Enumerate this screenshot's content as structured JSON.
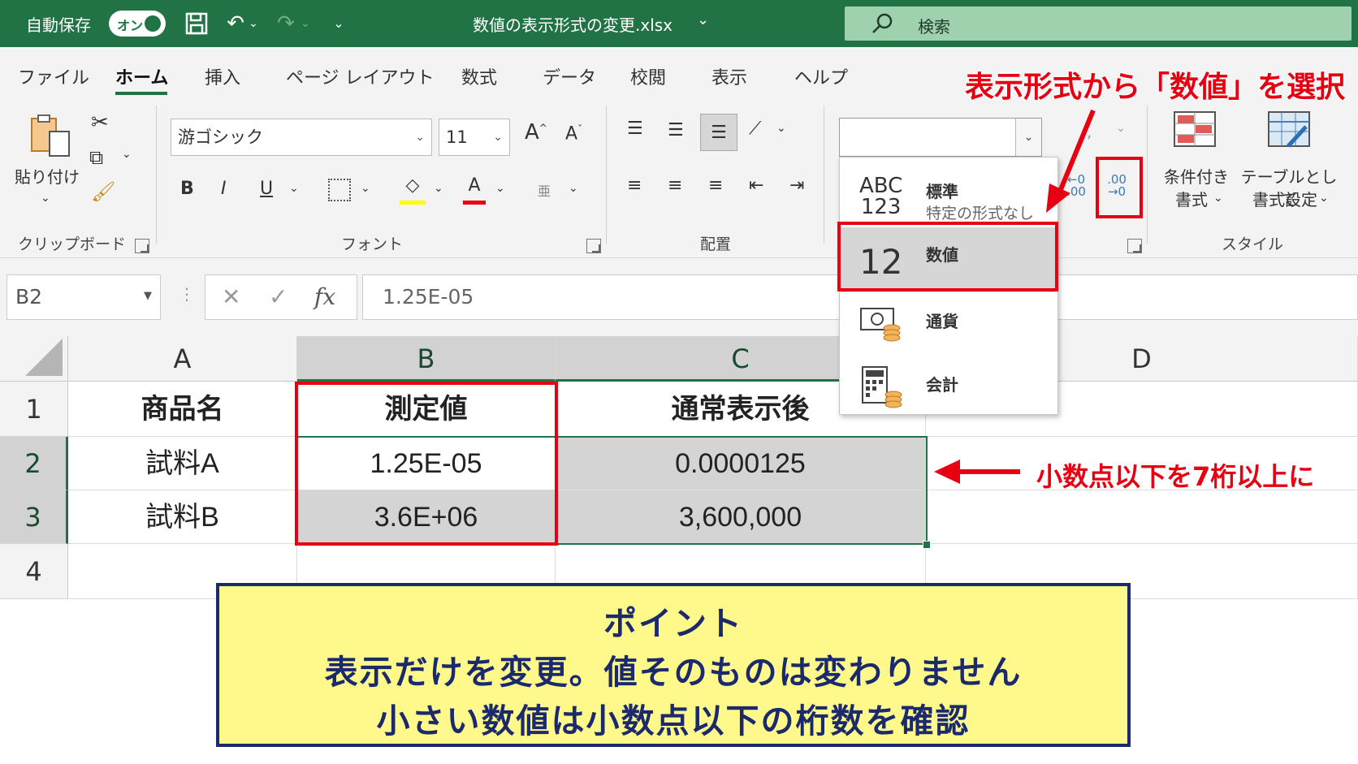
{
  "titlebar": {
    "autosave_label": "自動保存",
    "autosave_state": "オン",
    "document_title": "数値の表示形式の変更.xlsx",
    "search_placeholder": "検索",
    "accent_color": "#217346"
  },
  "tabs": [
    "ファイル",
    "ホーム",
    "挿入",
    "ページ レイアウト",
    "数式",
    "データ",
    "校閲",
    "表示",
    "ヘルプ"
  ],
  "active_tab": "ホーム",
  "ribbon": {
    "clipboard": {
      "paste_label": "貼り付け",
      "group_label": "クリップボード"
    },
    "font": {
      "font_name": "游ゴシック",
      "font_size": "11",
      "group_label": "フォント"
    },
    "alignment": {
      "group_label": "配置"
    },
    "styles": {
      "conditional_label_1": "条件付き",
      "conditional_label_2": "書式",
      "table_label_1": "テーブルとして",
      "table_label_2": "書式設定",
      "group_label": "スタイル"
    }
  },
  "number_format_dropdown": {
    "items": [
      {
        "icon": "abc-123-icon",
        "icon_text_1": "ABC",
        "icon_text_2": "123",
        "title": "標準",
        "subtitle": "特定の形式なし"
      },
      {
        "icon": "number-12-icon",
        "icon_text_1": "12",
        "title": "数値"
      },
      {
        "icon": "currency-icon",
        "title": "通貨"
      },
      {
        "icon": "accounting-icon",
        "title": "会計"
      }
    ],
    "selected": "数値"
  },
  "formula_bar": {
    "name_box": "B2",
    "formula": "1.25E-05"
  },
  "sheet": {
    "columns": [
      "A",
      "B",
      "C",
      "D"
    ],
    "rows": [
      "1",
      "2",
      "3",
      "4"
    ],
    "cells": {
      "A1": "商品名",
      "B1": "測定値",
      "C1": "通常表示後",
      "A2": "試料A",
      "B2": "1.25E-05",
      "C2": "0.0000125",
      "A3": "試料B",
      "B3": "3.6E+06",
      "C3": "3,600,000"
    }
  },
  "annotations": {
    "top_callout": "表示形式から「数値」を選択",
    "side_callout": "小数点以下を7桁以上に",
    "increase_decimal_label_1": ".00",
    "increase_decimal_label_2": "→0",
    "decrease_decimal_label_1": "←0",
    "decrease_decimal_label_2": ".00",
    "highlight_color": "#e60012"
  },
  "note": {
    "line1": "ポイント",
    "line2": "表示だけを変更。値そのものは変わりません",
    "line3": "小さい数値は小数点以下の桁数を確認",
    "background": "#fff98c",
    "border": "#1a2a6c"
  }
}
